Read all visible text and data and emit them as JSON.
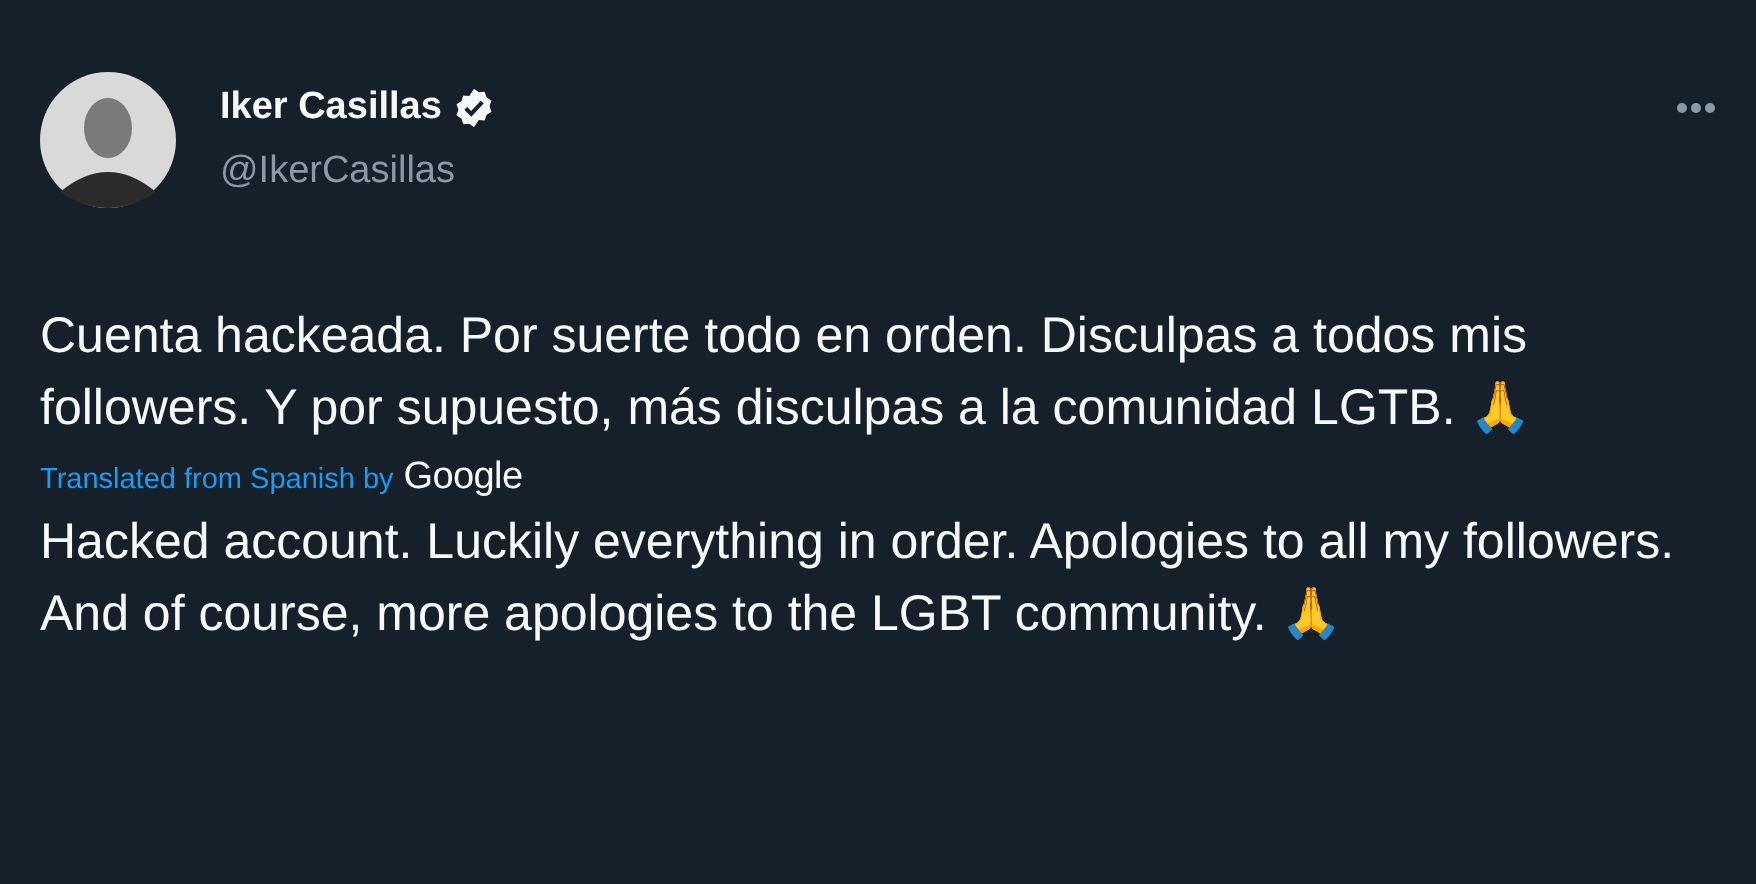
{
  "author": {
    "name": "Iker Casillas",
    "handle": "@IkerCasillas",
    "verified": true
  },
  "tweet_text": "Cuenta hackeada. Por suerte todo en orden. Disculpas a todos mis followers. Y por supuesto, más disculpas a la comunidad LGTB. 🙏",
  "translation": {
    "label": "Translated from Spanish by",
    "provider": "Google",
    "text": "Hacked account. Luckily everything in order. Apologies to all my followers. And of course, more apologies to the LGBT community. 🙏"
  }
}
